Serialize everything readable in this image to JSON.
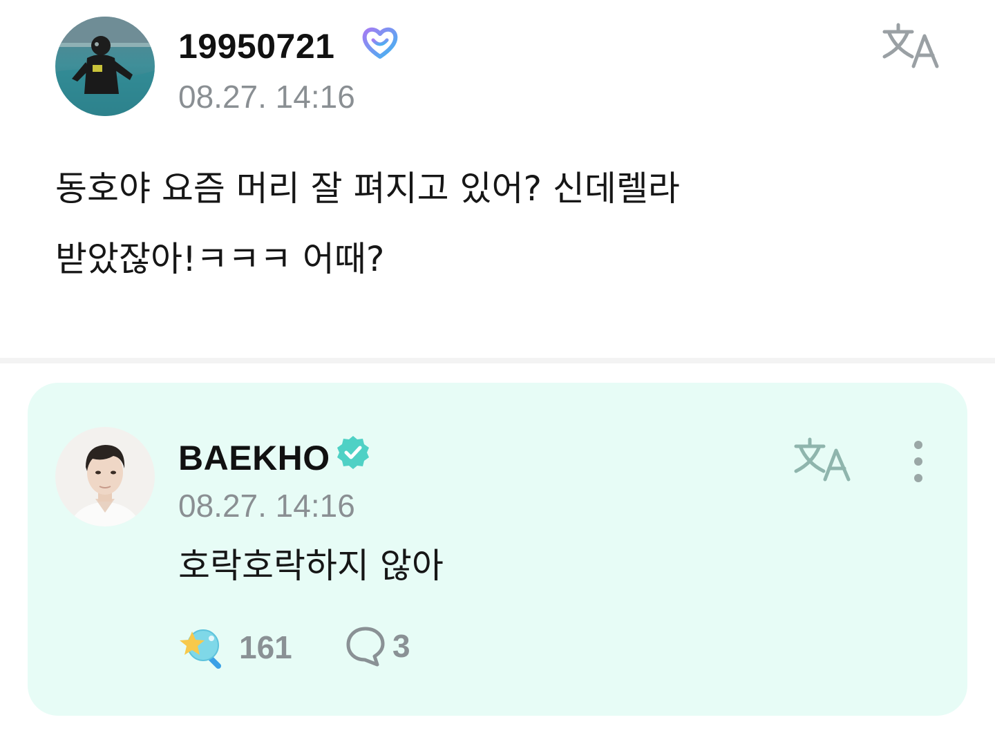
{
  "post": {
    "author": "19950721",
    "timestamp": "08.27. 14:16",
    "text": "동호야 요즘 머리 잘 펴지고 있어? 신데렐라\n받았잖아!ㅋㅋㅋ 어때?",
    "badge_icon": "fan-membership-badge-icon",
    "translate_icon": "translate-icon"
  },
  "reply": {
    "author": "BAEKHO",
    "timestamp": "08.27. 14:16",
    "text": "호락호락하지 않아",
    "badge_icon": "verified-badge-icon",
    "translate_icon": "translate-icon",
    "more_icon": "more-vertical-icon",
    "like_count": "161",
    "comment_count": "3",
    "card_color": "#e7fcf6",
    "accent_color": "#4fd1c5"
  }
}
